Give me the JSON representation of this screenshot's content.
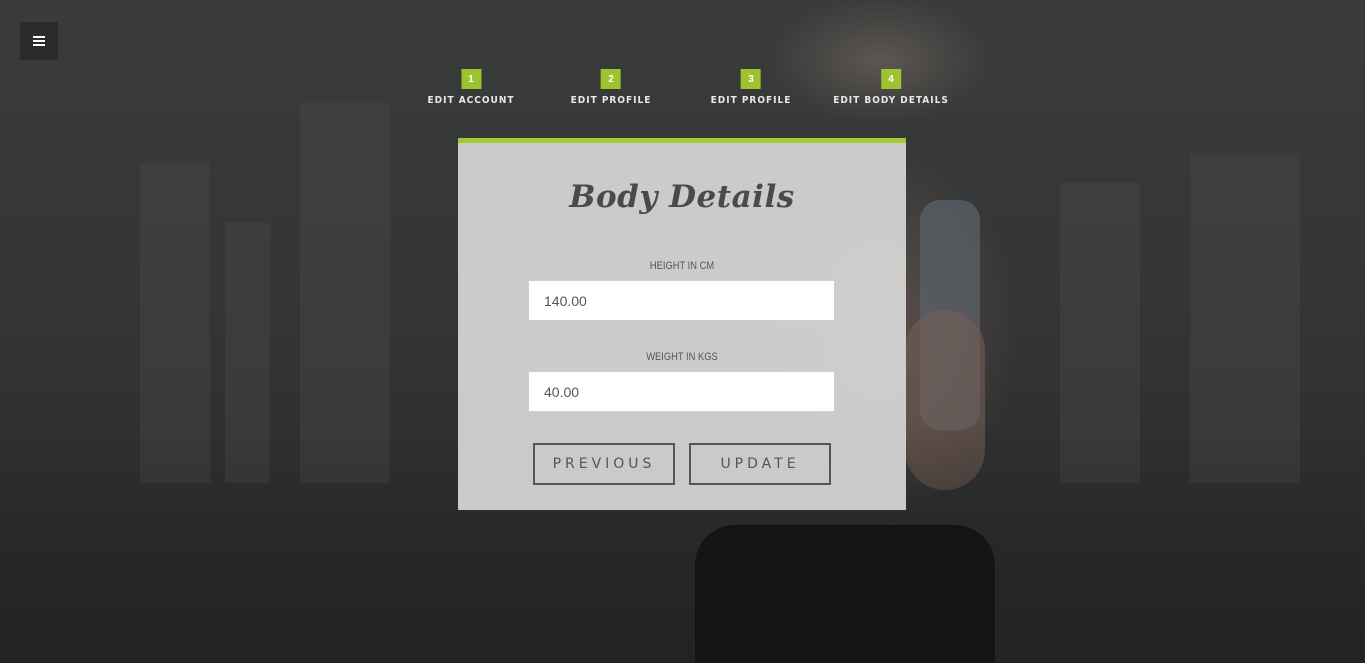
{
  "menu": {
    "icon": "hamburger-icon"
  },
  "steps": [
    {
      "number": "1",
      "label": "EDIT ACCOUNT"
    },
    {
      "number": "2",
      "label": "EDIT PROFILE"
    },
    {
      "number": "3",
      "label": "EDIT PROFILE"
    },
    {
      "number": "4",
      "label": "EDIT BODY DETAILS"
    }
  ],
  "form": {
    "title": "Body Details",
    "height_label": "HEIGHT IN CM",
    "height_value": "140.00",
    "weight_label": "WEIGHT IN KGS",
    "weight_value": "40.00",
    "previous_label": "PREVIOUS",
    "update_label": "UPDATE"
  },
  "colors": {
    "accent": "#a4c639",
    "card_bg": "#dcdcdc",
    "text": "#555555"
  }
}
